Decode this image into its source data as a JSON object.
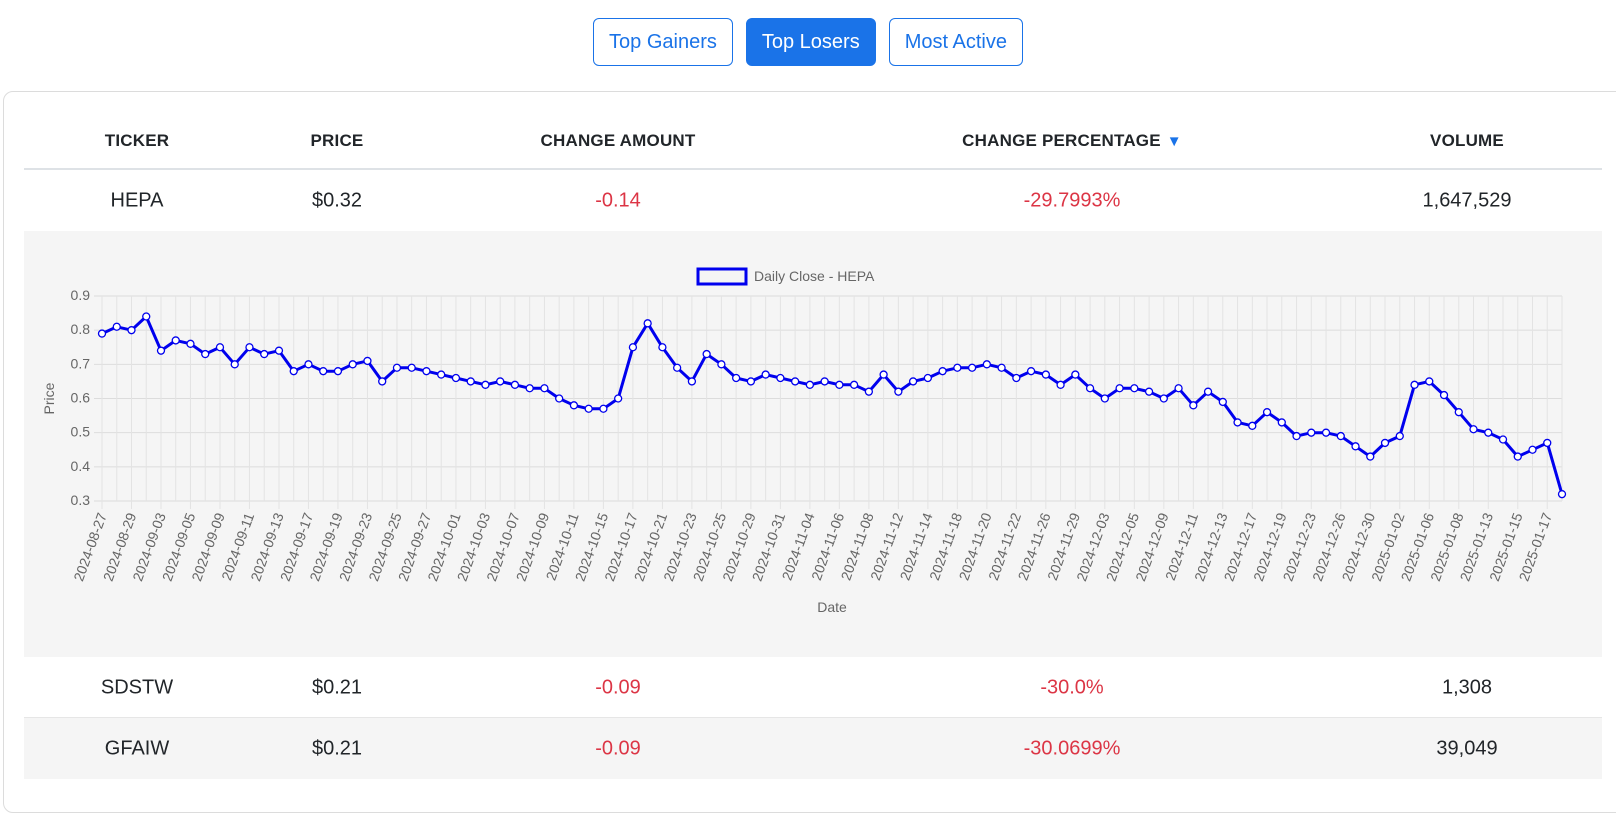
{
  "tabs": [
    {
      "label": "Top Gainers",
      "active": false
    },
    {
      "label": "Top Losers",
      "active": true
    },
    {
      "label": "Most Active",
      "active": false
    }
  ],
  "table": {
    "headers": [
      "TICKER",
      "PRICE",
      "CHANGE AMOUNT",
      "CHANGE PERCENTAGE",
      "VOLUME"
    ],
    "sort_icon": "▼",
    "rows": [
      {
        "ticker": "HEPA",
        "price": "$0.32",
        "change_amount": "-0.14",
        "change_percentage": "-29.7993%",
        "volume": "1,647,529"
      },
      {
        "ticker": "SDSTW",
        "price": "$0.21",
        "change_amount": "-0.09",
        "change_percentage": "-30.0%",
        "volume": "1,308"
      },
      {
        "ticker": "GFAIW",
        "price": "$0.21",
        "change_amount": "-0.09",
        "change_percentage": "-30.0699%",
        "volume": "39,049"
      }
    ]
  },
  "colors": {
    "accent": "#1a73e8",
    "negative": "#dc3545",
    "line": "#0000ee"
  },
  "chart_data": {
    "type": "line",
    "xlabel": "Date",
    "ylabel": "Price",
    "ylim": [
      0.3,
      0.9
    ],
    "yticks": [
      0.3,
      0.4,
      0.5,
      0.6,
      0.7,
      0.8,
      0.9
    ],
    "grid": true,
    "legend_position": "top-center",
    "x_tick_labels": [
      "2024-08-27",
      "2024-08-29",
      "2024-09-03",
      "2024-09-05",
      "2024-09-09",
      "2024-09-11",
      "2024-09-13",
      "2024-09-17",
      "2024-09-19",
      "2024-09-23",
      "2024-09-25",
      "2024-09-27",
      "2024-10-01",
      "2024-10-03",
      "2024-10-07",
      "2024-10-09",
      "2024-10-11",
      "2024-10-15",
      "2024-10-17",
      "2024-10-21",
      "2024-10-23",
      "2024-10-25",
      "2024-10-29",
      "2024-10-31",
      "2024-11-04",
      "2024-11-06",
      "2024-11-08",
      "2024-11-12",
      "2024-11-14",
      "2024-11-18",
      "2024-11-20",
      "2024-11-22",
      "2024-11-26",
      "2024-11-29",
      "2024-12-03",
      "2024-12-05",
      "2024-12-09",
      "2024-12-11",
      "2024-12-13",
      "2024-12-17",
      "2024-12-19",
      "2024-12-23",
      "2024-12-26",
      "2024-12-30",
      "2025-01-02",
      "2025-01-06",
      "2025-01-08",
      "2025-01-13",
      "2025-01-15",
      "2025-01-17"
    ],
    "series": [
      {
        "name": "Daily Close - HEPA",
        "values": [
          0.79,
          0.81,
          0.8,
          0.84,
          0.74,
          0.77,
          0.76,
          0.73,
          0.75,
          0.7,
          0.75,
          0.73,
          0.74,
          0.68,
          0.7,
          0.68,
          0.68,
          0.7,
          0.71,
          0.65,
          0.69,
          0.69,
          0.68,
          0.67,
          0.66,
          0.65,
          0.64,
          0.65,
          0.64,
          0.63,
          0.63,
          0.6,
          0.58,
          0.57,
          0.57,
          0.6,
          0.75,
          0.82,
          0.75,
          0.69,
          0.65,
          0.73,
          0.7,
          0.66,
          0.65,
          0.67,
          0.66,
          0.65,
          0.64,
          0.65,
          0.64,
          0.64,
          0.62,
          0.67,
          0.62,
          0.65,
          0.66,
          0.68,
          0.69,
          0.69,
          0.7,
          0.69,
          0.66,
          0.68,
          0.67,
          0.64,
          0.67,
          0.63,
          0.6,
          0.63,
          0.63,
          0.62,
          0.6,
          0.63,
          0.58,
          0.62,
          0.59,
          0.53,
          0.52,
          0.56,
          0.53,
          0.49,
          0.5,
          0.5,
          0.49,
          0.46,
          0.43,
          0.47,
          0.49,
          0.64,
          0.65,
          0.61,
          0.56,
          0.51,
          0.5,
          0.48,
          0.43,
          0.45,
          0.47,
          0.32
        ]
      }
    ]
  }
}
